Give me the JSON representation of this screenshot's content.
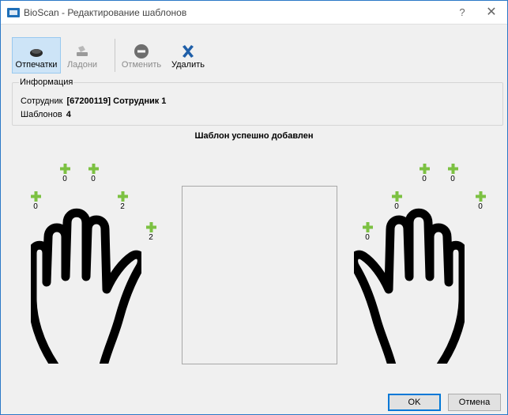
{
  "window": {
    "title": "BioScan - Редактирование шаблонов",
    "help_label": "?",
    "close_label": "✕"
  },
  "toolbar": {
    "fingerprints_label": "Отпечатки",
    "palms_label": "Ладони",
    "cancel_label": "Отменить",
    "delete_label": "Удалить"
  },
  "info": {
    "legend": "Информация",
    "employee_label": "Сотрудник",
    "employee_value": "[67200119] Сотрудник 1",
    "templates_label": "Шаблонов",
    "templates_value": "4"
  },
  "status_message": "Шаблон успешно добавлен",
  "left_hand": {
    "pinky": "0",
    "ring": "0",
    "middle": "0",
    "index": "2",
    "thumb": "2"
  },
  "right_hand": {
    "thumb": "0",
    "index": "0",
    "middle": "0",
    "ring": "0",
    "pinky": "0"
  },
  "buttons": {
    "ok_label": "OK",
    "cancel_label": "Отмена"
  },
  "colors": {
    "accent": "#0078d7",
    "plus_green": "#7cc142",
    "active_tab": "#cde4f7"
  }
}
